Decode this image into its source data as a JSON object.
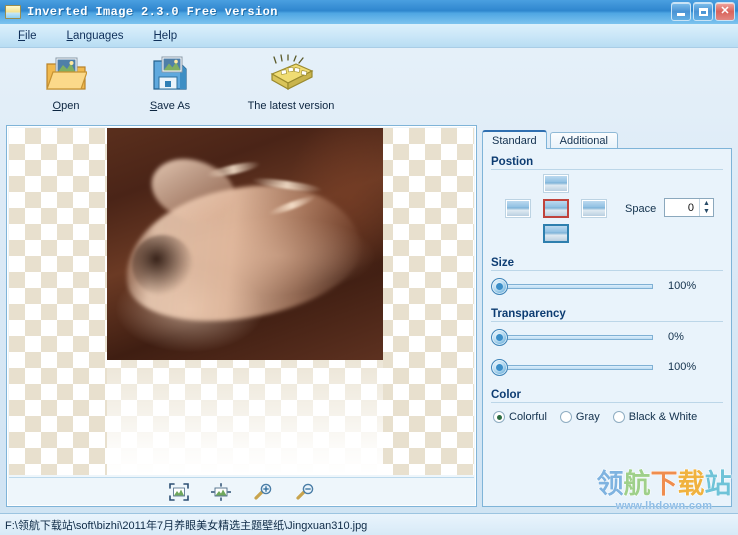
{
  "window": {
    "title": "Inverted Image 2.3.0 Free version",
    "icon": "app-image-icon",
    "minimize_label": "_",
    "maximize_label": "□",
    "close_label": "✕"
  },
  "menubar": {
    "items": [
      {
        "label": "File",
        "accel": "F"
      },
      {
        "label": "Languages",
        "accel": "L"
      },
      {
        "label": "Help",
        "accel": "H"
      }
    ]
  },
  "toolbar": {
    "buttons": [
      {
        "label": "Open",
        "accel": "O",
        "icon": "open-folder-icon"
      },
      {
        "label": "Save As",
        "accel": "S",
        "icon": "floppy-save-icon"
      },
      {
        "label": "The latest version",
        "accel": "",
        "icon": "news-sparkle-icon"
      }
    ]
  },
  "canvas": {
    "tools": [
      {
        "name": "fit-to-window-icon",
        "tooltip": "Fit to window"
      },
      {
        "name": "actual-size-icon",
        "tooltip": "Actual size"
      },
      {
        "name": "zoom-in-icon",
        "tooltip": "Zoom in"
      },
      {
        "name": "zoom-out-icon",
        "tooltip": "Zoom out"
      }
    ]
  },
  "panel": {
    "tabs": [
      {
        "label": "Standard",
        "active": true
      },
      {
        "label": "Additional",
        "active": false
      }
    ],
    "position": {
      "title": "Postion",
      "thumbs": [
        {
          "name": "position-top",
          "state": "normal"
        },
        {
          "name": "position-left",
          "state": "normal"
        },
        {
          "name": "position-center",
          "state": "hover"
        },
        {
          "name": "position-right",
          "state": "normal"
        },
        {
          "name": "position-bottom",
          "state": "selected"
        }
      ],
      "space_label": "Space",
      "space_value": "0"
    },
    "size": {
      "title": "Size",
      "value": "100%",
      "percent": 0
    },
    "transparency": {
      "title": "Transparency",
      "start": {
        "value": "0%",
        "percent": 0
      },
      "end": {
        "value": "100%",
        "percent": 0
      }
    },
    "color": {
      "title": "Color",
      "options": [
        {
          "label": "Colorful",
          "selected": true
        },
        {
          "label": "Gray",
          "selected": false
        },
        {
          "label": "Black & White",
          "selected": false
        }
      ]
    }
  },
  "statusbar": {
    "path": "F:\\领航下载站\\soft\\bizhi\\2011年7月养眼美女精选主题壁纸\\Jingxuan310.jpg"
  },
  "watermark": {
    "chars": [
      "领",
      "航",
      "下",
      "载",
      "站"
    ],
    "url": "www.lhdown.com"
  },
  "colors": {
    "titlebar": "#2f86ce",
    "accent": "#0d3c72",
    "panel_bg": "#e9f3fb",
    "border": "#7fb4d8"
  }
}
